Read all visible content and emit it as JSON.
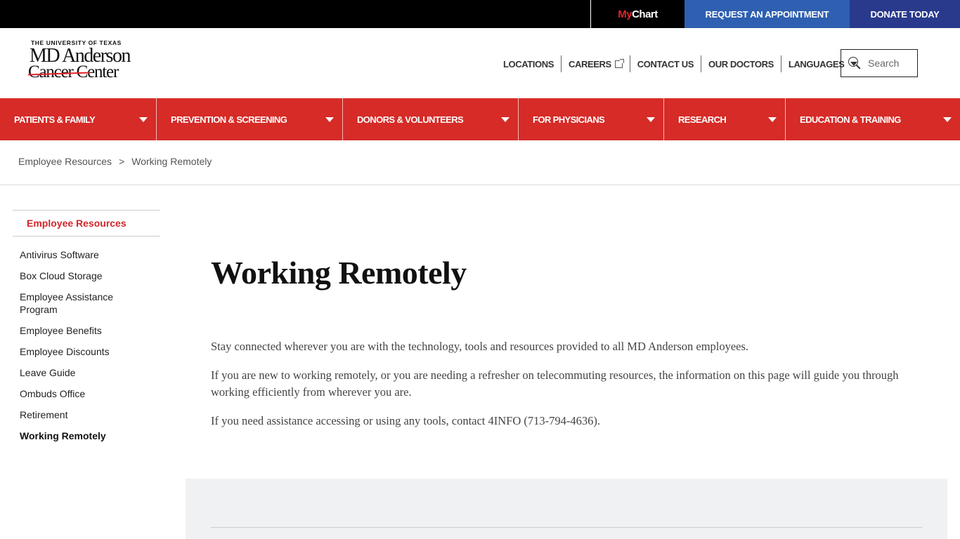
{
  "topbar": {
    "mychart_my": "My",
    "mychart_chart": "Chart",
    "request_appointment": "REQUEST AN APPOINTMENT",
    "donate": "DONATE TODAY"
  },
  "logo": {
    "line1": "THE UNIVERSITY OF TEXAS",
    "line2": "MD Anderson",
    "line3": "Cancer Center"
  },
  "utility_nav": [
    {
      "label": "LOCATIONS"
    },
    {
      "label": "CAREERS",
      "icon": "external-link-icon"
    },
    {
      "label": "CONTACT US"
    },
    {
      "label": "OUR DOCTORS"
    },
    {
      "label": "LANGUAGES",
      "icon": "caret-down-icon"
    }
  ],
  "search": {
    "placeholder": "Search"
  },
  "main_nav": [
    {
      "label": "PATIENTS & FAMILY"
    },
    {
      "label": "PREVENTION & SCREENING"
    },
    {
      "label": "DONORS & VOLUNTEERS"
    },
    {
      "label": "FOR PHYSICIANS"
    },
    {
      "label": "RESEARCH"
    },
    {
      "label": "EDUCATION & TRAINING"
    }
  ],
  "breadcrumb": {
    "items": [
      "Employee Resources",
      "Working Remotely"
    ],
    "separator": ">"
  },
  "sidebar": {
    "heading": "Employee Resources",
    "items": [
      {
        "label": "Antivirus Software"
      },
      {
        "label": "Box Cloud Storage"
      },
      {
        "label": "Employee Assistance Program"
      },
      {
        "label": "Employee Benefits"
      },
      {
        "label": "Employee Discounts"
      },
      {
        "label": "Leave Guide"
      },
      {
        "label": "Ombuds Office"
      },
      {
        "label": "Retirement"
      },
      {
        "label": "Working Remotely",
        "active": true
      }
    ]
  },
  "page": {
    "title": "Working Remotely",
    "paragraphs": [
      "Stay connected wherever you are with the technology, tools and resources provided to all MD Anderson employees.",
      "If you are new to working remotely, or you are needing a refresher on telecommuting resources, the information on this page will guide you through working efficiently from wherever you are.",
      "If you need assistance accessing or using any tools, contact 4INFO (713-794-4636)."
    ]
  },
  "colors": {
    "brand_red": "#d62b27",
    "appointment_blue": "#2e5fb0",
    "donate_navy": "#293a8c",
    "sidebar_heading": "#d0262b"
  }
}
